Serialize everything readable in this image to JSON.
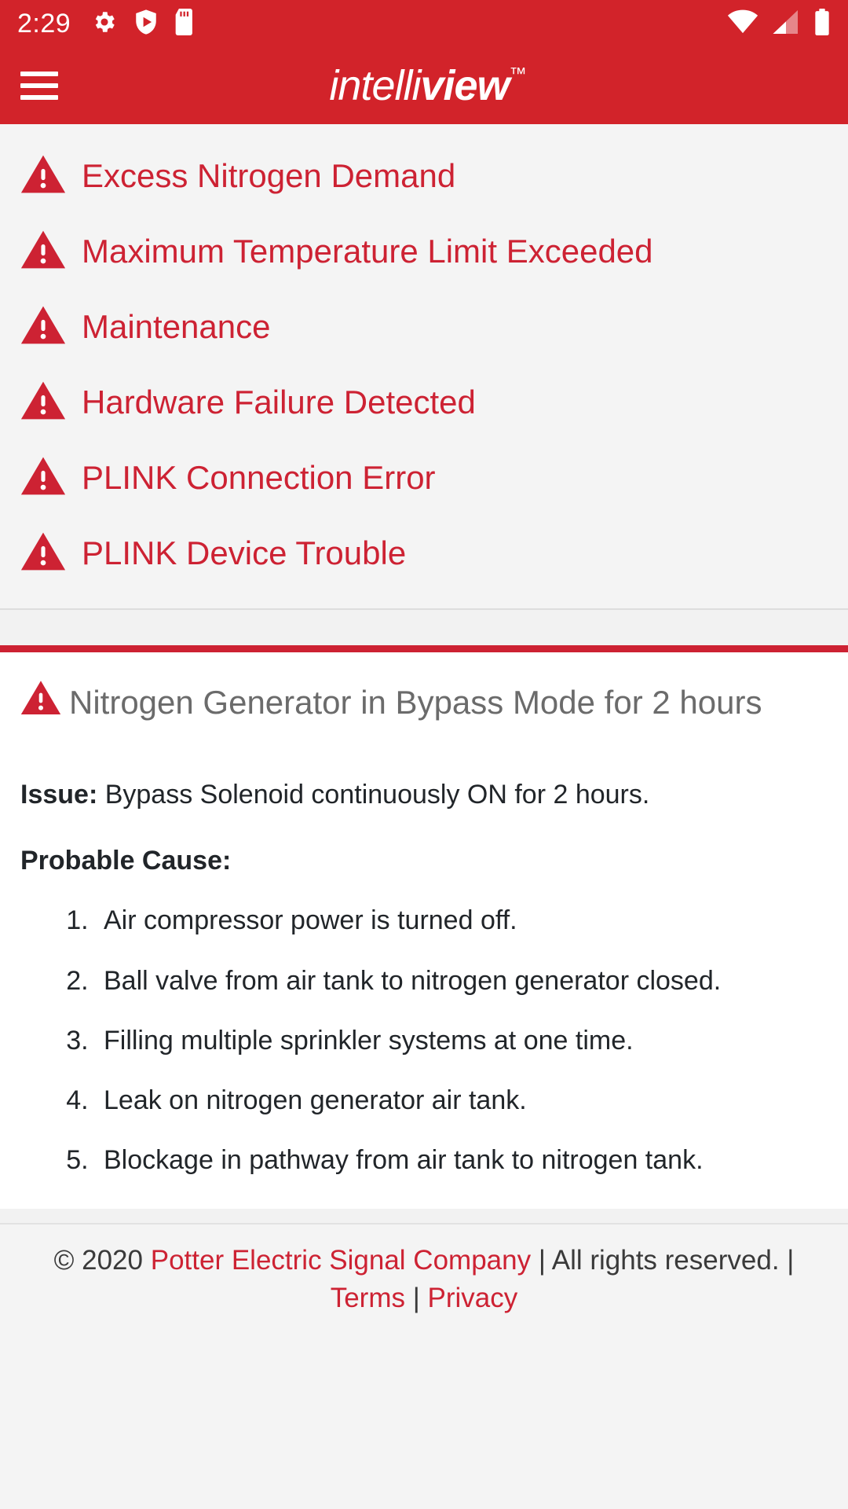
{
  "status_bar": {
    "clock": "2:29",
    "left_icons": [
      "gear-icon",
      "shield-play-icon",
      "sd-card-icon"
    ],
    "right_icons": [
      "wifi-icon",
      "cellular-signal-icon",
      "battery-icon"
    ]
  },
  "app_bar": {
    "menu_icon": "hamburger-menu-icon",
    "brand_thin": "intelli",
    "brand_bold": "view",
    "brand_trademark": "™"
  },
  "colors": {
    "brand_red": "#d2232a",
    "alert_red": "#cd2233",
    "page_bg": "#f4f4f4",
    "card_bg": "#ffffff",
    "title_gray": "#6b6b6b",
    "body_text": "#212529"
  },
  "alerts": [
    {
      "icon": "warning-triangle-icon",
      "label": "Excess Nitrogen Demand"
    },
    {
      "icon": "warning-triangle-icon",
      "label": "Maximum Temperature Limit Exceeded"
    },
    {
      "icon": "warning-triangle-icon",
      "label": "Maintenance"
    },
    {
      "icon": "warning-triangle-icon",
      "label": "Hardware Failure Detected"
    },
    {
      "icon": "warning-triangle-icon",
      "label": "PLINK Connection Error"
    },
    {
      "icon": "warning-triangle-icon",
      "label": "PLINK Device Trouble"
    }
  ],
  "detail": {
    "icon": "warning-triangle-icon",
    "title": "Nitrogen Generator in Bypass Mode for 2 hours",
    "issue_label": "Issue:",
    "issue_text": " Bypass Solenoid continuously ON for 2 hours.",
    "cause_label": "Probable Cause:",
    "causes": [
      "Air compressor power is turned off.",
      "Ball valve from air tank to nitrogen generator closed.",
      "Filling multiple sprinkler systems at one time.",
      "Leak on nitrogen generator air tank.",
      "Blockage in pathway from air tank to nitrogen tank."
    ]
  },
  "footer": {
    "copyright": "© 2020 ",
    "company_link": "Potter Electric Signal Company",
    "rights": " | All rights reserved. | ",
    "terms_link": "Terms",
    "links_sep": " | ",
    "privacy_link": "Privacy"
  }
}
